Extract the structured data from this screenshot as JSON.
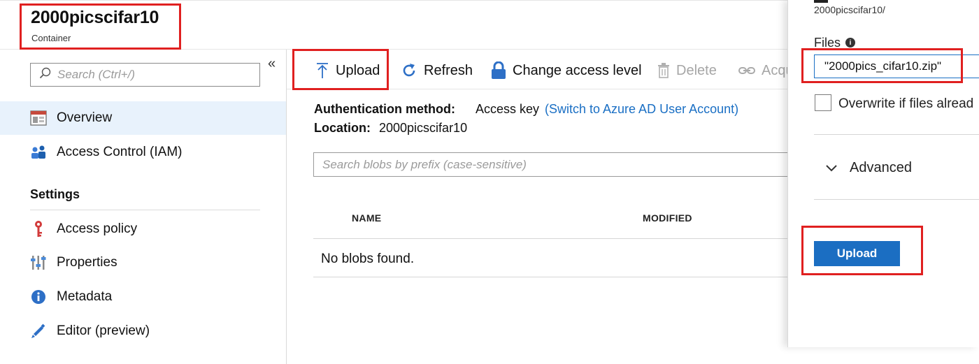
{
  "header": {
    "title": "2000picscifar10",
    "subtitle": "Container"
  },
  "nav": {
    "search_placeholder": "Search (Ctrl+/)",
    "collapse_glyph": "«",
    "items": [
      {
        "label": "Overview",
        "icon": "overview-icon",
        "active": true
      },
      {
        "label": "Access Control (IAM)",
        "icon": "people-icon",
        "active": false
      }
    ],
    "section_title": "Settings",
    "settings_items": [
      {
        "label": "Access policy",
        "icon": "key-icon"
      },
      {
        "label": "Properties",
        "icon": "sliders-icon"
      },
      {
        "label": "Metadata",
        "icon": "info-icon"
      },
      {
        "label": "Editor (preview)",
        "icon": "pencil-icon"
      }
    ]
  },
  "toolbar": {
    "upload": "Upload",
    "refresh": "Refresh",
    "change_access": "Change access level",
    "delete": "Delete",
    "acquire": "Acqu"
  },
  "details": {
    "auth_label": "Authentication method:",
    "auth_value": "Access key",
    "auth_link": "(Switch to Azure AD User Account)",
    "location_label": "Location:",
    "location_value": "2000picscifar10"
  },
  "blobs": {
    "search_placeholder": "Search blobs by prefix (case-sensitive)",
    "columns": [
      "NAME",
      "MODIFIED"
    ],
    "empty_text": "No blobs found."
  },
  "upload_panel": {
    "path": "2000picscifar10/",
    "files_label": "Files",
    "files_value": "\"2000pics_cifar10.zip\"",
    "overwrite_label": "Overwrite if files alread",
    "advanced_label": "Advanced",
    "upload_button": "Upload"
  },
  "colors": {
    "accent": "#1b6ec2",
    "link": "#1a6fc4",
    "highlight_box": "#e02020",
    "active_nav": "#e8f2fc"
  }
}
